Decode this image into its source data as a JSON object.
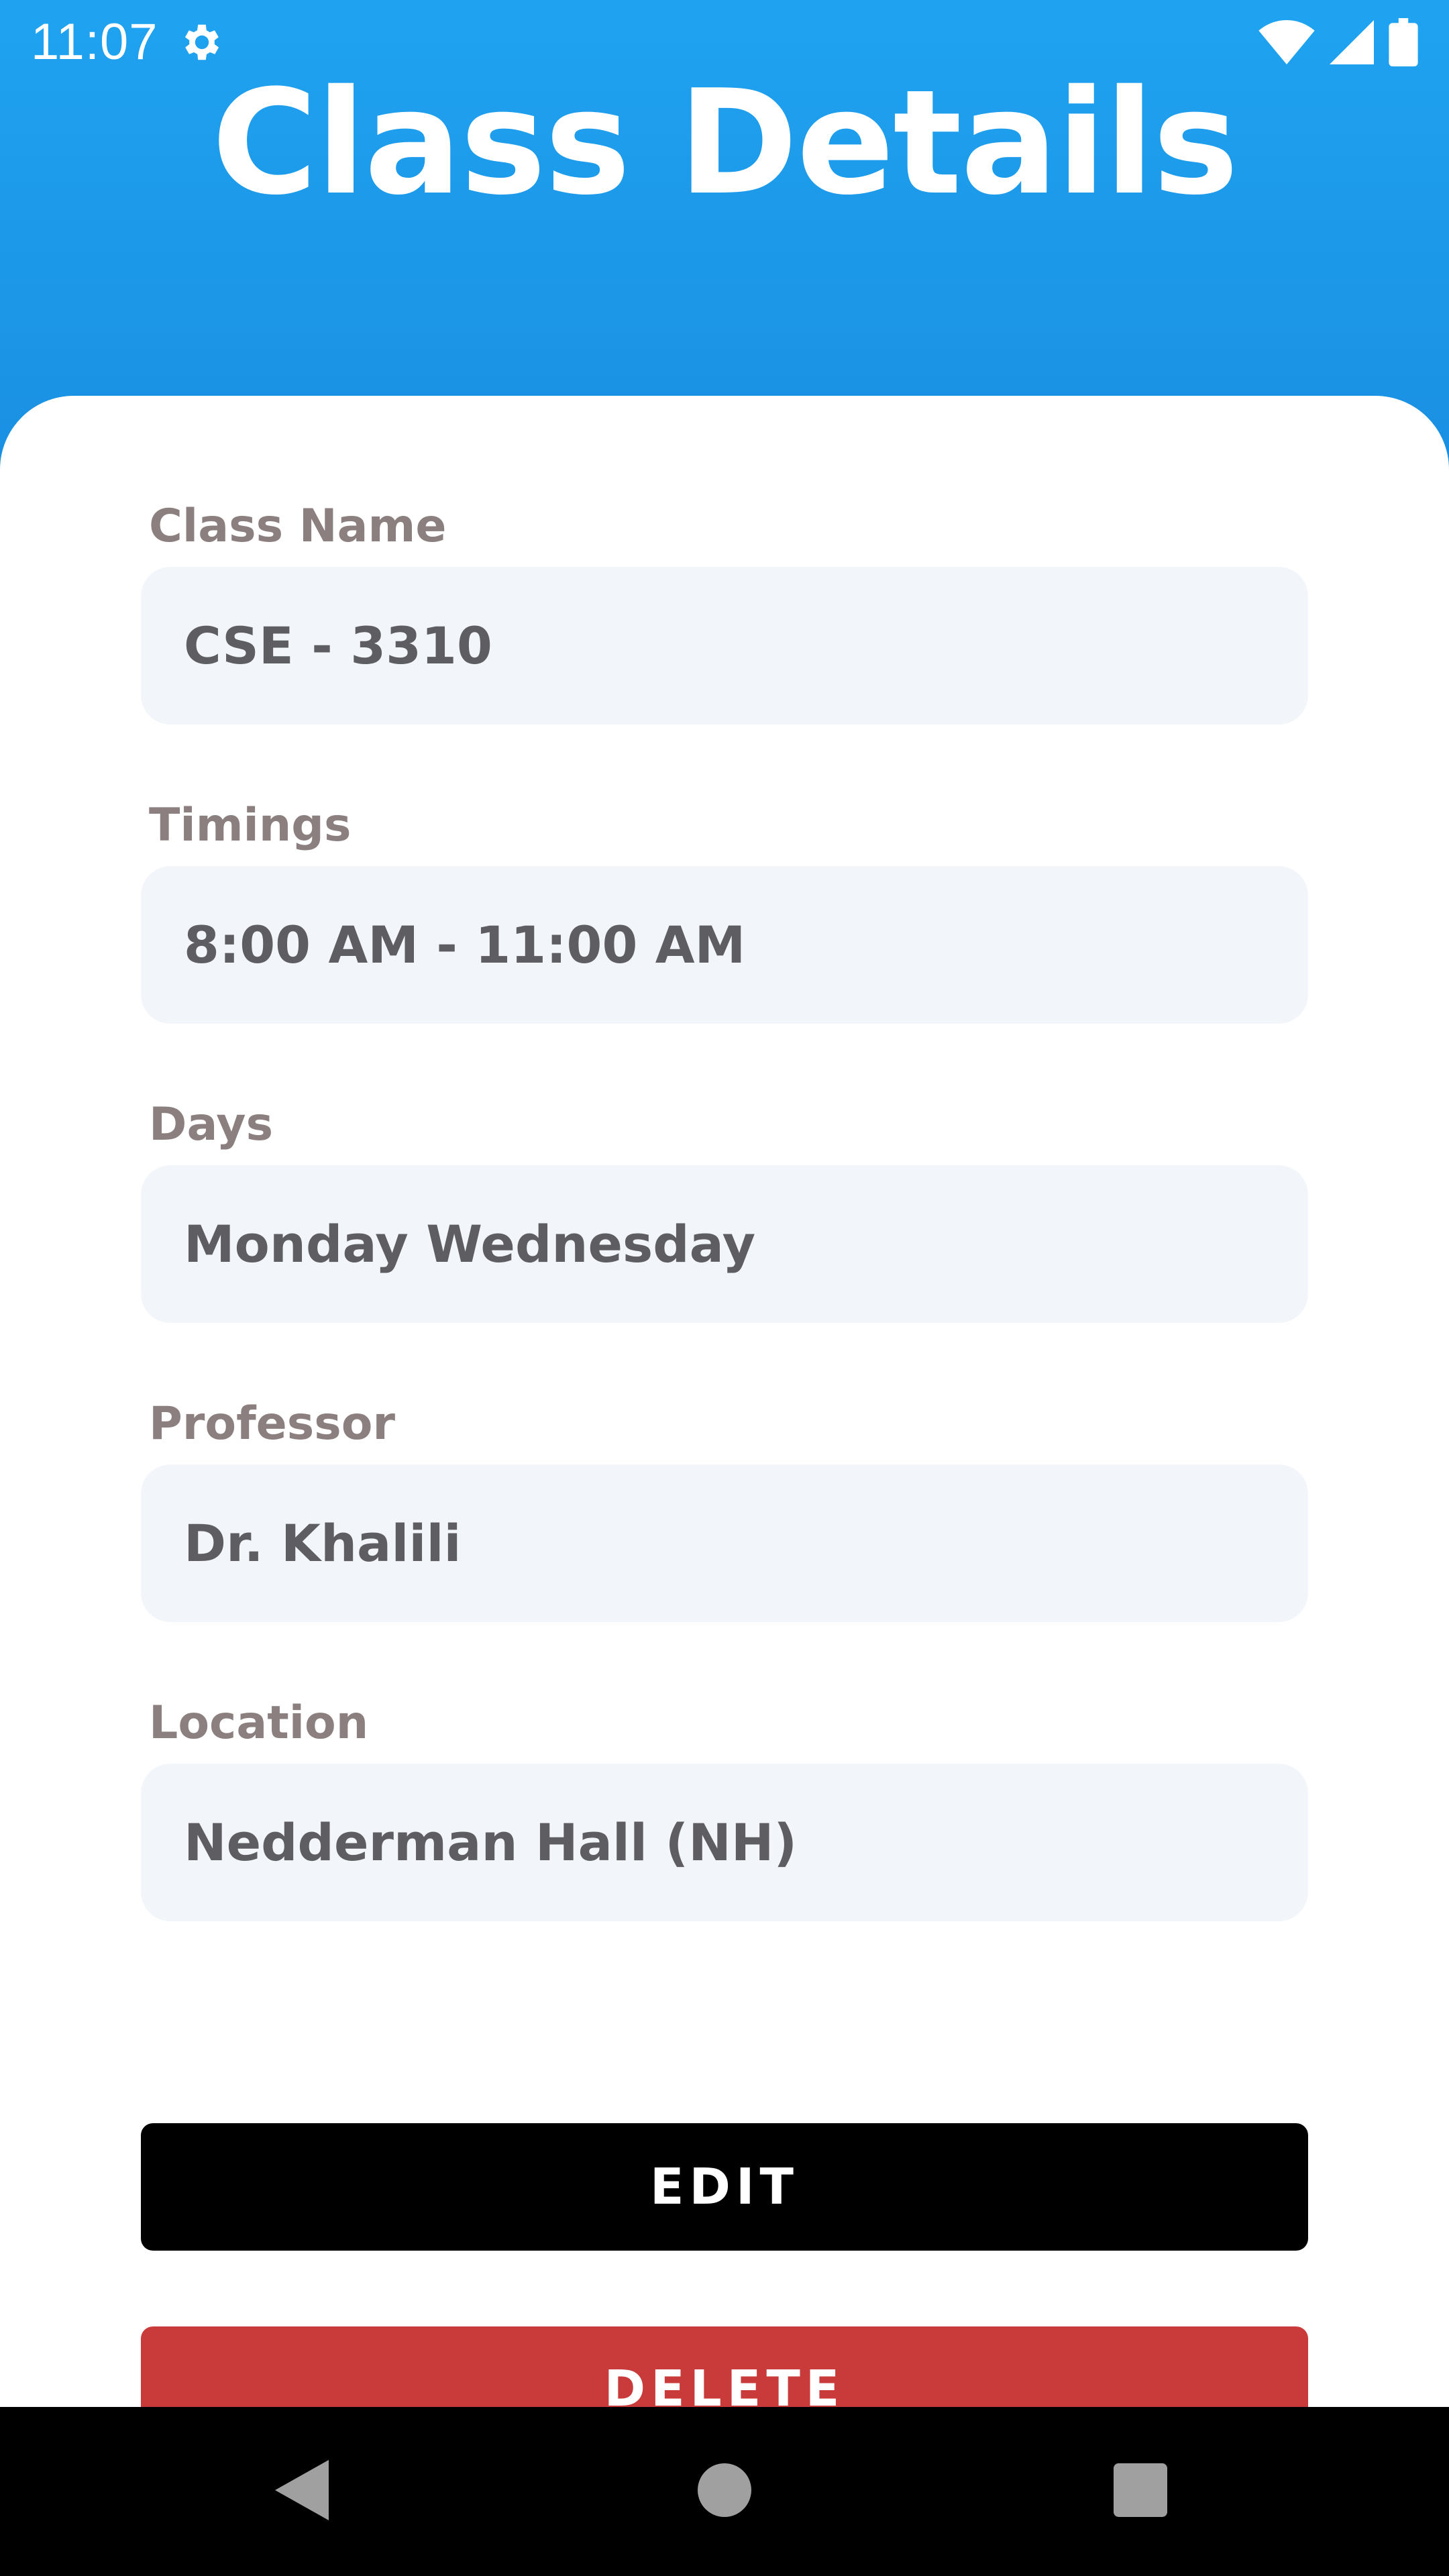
{
  "status_bar": {
    "time": "11:07",
    "icons": [
      "settings-gear-icon",
      "wifi-icon",
      "cellular-signal-icon",
      "battery-icon"
    ]
  },
  "header": {
    "title": "Class Details",
    "color": "#1fa3f0"
  },
  "fields": {
    "class_name": {
      "label": "Class Name",
      "value": "CSE - 3310"
    },
    "timings": {
      "label": "Timings",
      "value": "8:00 AM - 11:00 AM"
    },
    "days": {
      "label": "Days",
      "value": "Monday Wednesday"
    },
    "professor": {
      "label": "Professor",
      "value": "Dr. Khalili"
    },
    "location": {
      "label": "Location",
      "value": "Nedderman Hall (NH)"
    }
  },
  "actions": {
    "edit_label": "EDIT",
    "delete_label": "DELETE",
    "edit_color": "#000000",
    "delete_color": "#c93a3a"
  },
  "nav_bar": {
    "icons": [
      "back-icon",
      "home-icon",
      "recents-icon"
    ]
  }
}
